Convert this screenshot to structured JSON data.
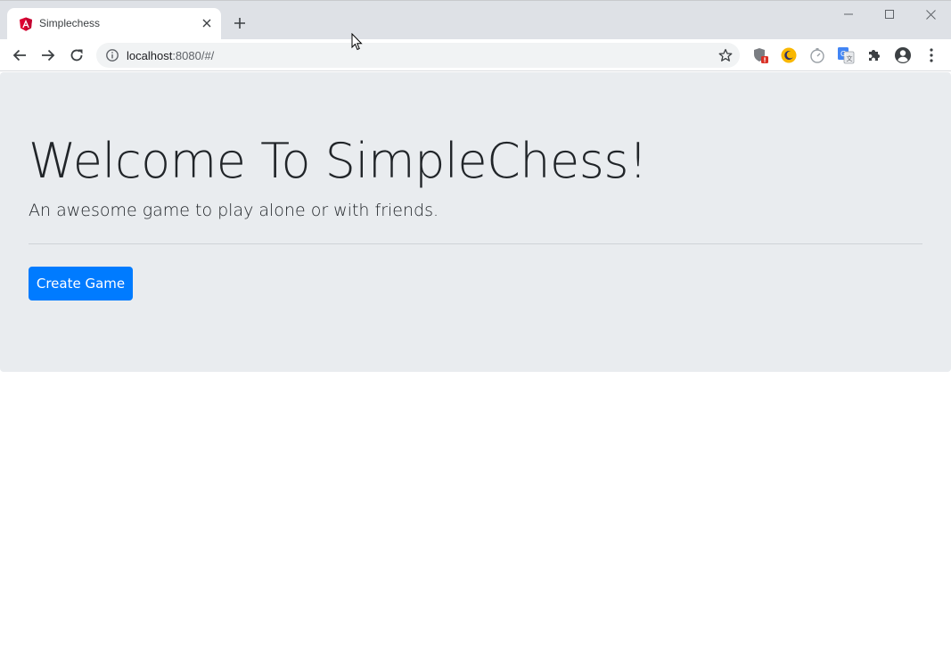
{
  "browser": {
    "tab": {
      "title": "Simplechess",
      "favicon": "angular-icon"
    },
    "address_bar": {
      "host": "localhost",
      "path": ":8080/#/"
    },
    "extensions": [
      "shield-alert-icon",
      "night-mode-icon",
      "timer-icon",
      "translate-icon",
      "puzzle-icon",
      "profile-icon"
    ],
    "accent_colors": {
      "tab_strip": "#dee1e6",
      "omnibox": "#f1f3f4"
    }
  },
  "page": {
    "title": "Welcome To SimpleChess!",
    "lead": "An awesome game to play alone or with friends.",
    "create_button_label": "Create Game",
    "colors": {
      "jumbotron": "#e9ecef",
      "primary": "#007bff"
    }
  }
}
